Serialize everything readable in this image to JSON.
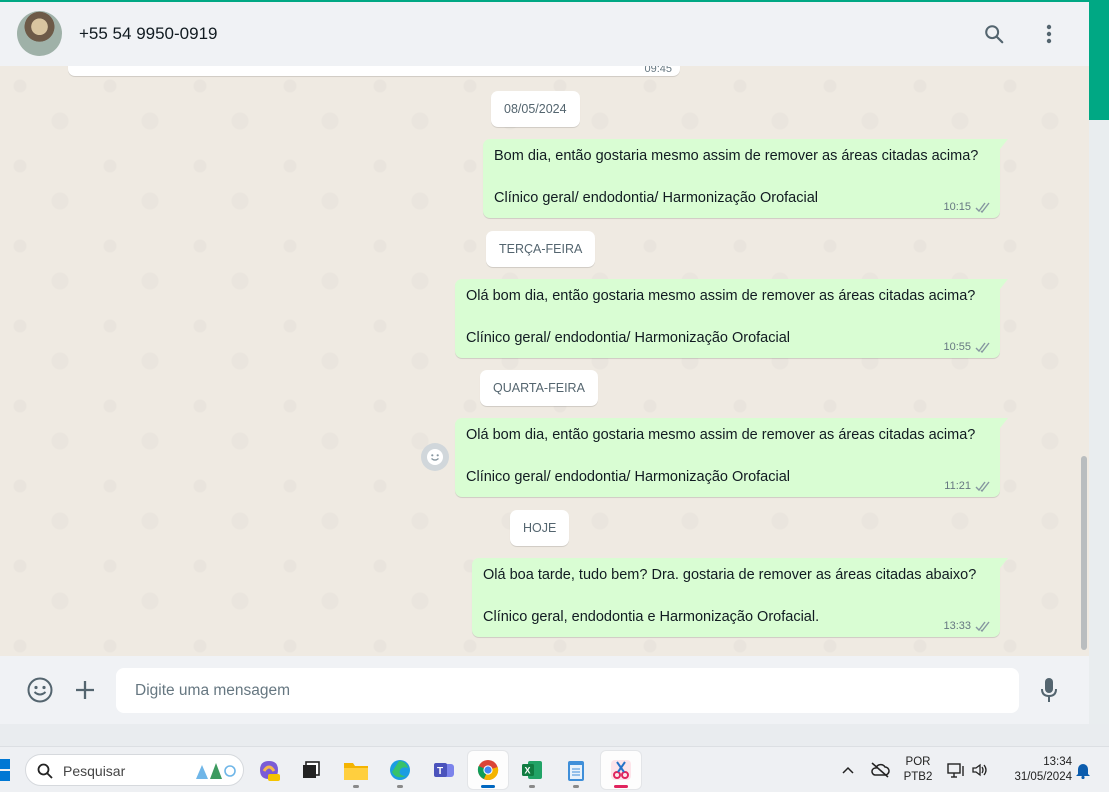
{
  "chat_header": {
    "contact_name": "+55 54 9950-0919"
  },
  "previous_message": {
    "time": "09:45"
  },
  "messages": [
    {
      "date_chip": "08/05/2024",
      "line1": "Bom dia, então gostaria mesmo assim de remover as áreas citadas acima?",
      "line2": "Clínico geral/ endodontia/ Harmonização Orofacial",
      "time": "10:15"
    },
    {
      "date_chip": "TERÇA-FEIRA",
      "line1": "Olá bom dia, então gostaria mesmo assim de remover as áreas citadas acima?",
      "line2": "Clínico geral/ endodontia/ Harmonização Orofacial",
      "time": "10:55"
    },
    {
      "date_chip": "QUARTA-FEIRA",
      "line1": "Olá bom dia, então gostaria mesmo assim de remover as áreas citadas acima?",
      "line2": "Clínico geral/ endodontia/ Harmonização Orofacial",
      "time": "11:21"
    },
    {
      "date_chip": "HOJE",
      "line1": "Olá boa tarde, tudo bem? Dra. gostaria de remover as áreas citadas abaixo?",
      "line2": "Clínico geral, endodontia e  Harmonização Orofacial.",
      "time": "13:33"
    }
  ],
  "composer": {
    "placeholder": "Digite uma mensagem"
  },
  "taskbar": {
    "search_label": "Pesquisar",
    "language_line1": "POR",
    "language_line2": "PTB2",
    "clock_time": "13:34",
    "clock_date": "31/05/2024"
  },
  "colors": {
    "accent": "#00a884",
    "outgoing_bubble": "#d9fdd3",
    "chat_background": "#efeae2",
    "header_background": "#f0f2f5"
  },
  "icons": {
    "search": "search-icon",
    "menu": "kebab-menu-icon",
    "emoji": "emoji-icon",
    "attach": "plus-icon",
    "mic": "microphone-icon",
    "ticks": "double-check-icon"
  }
}
